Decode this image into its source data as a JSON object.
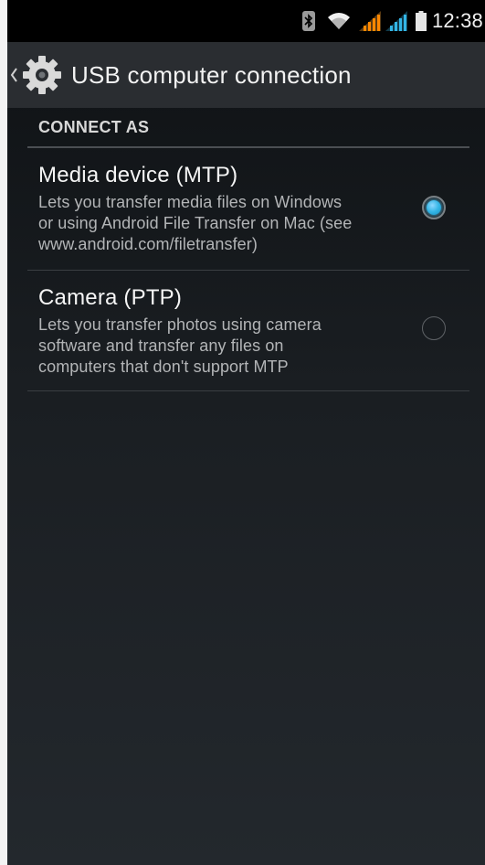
{
  "status_bar": {
    "time": "12:38",
    "icons": [
      "bluetooth-icon",
      "wifi-icon",
      "signal-icon",
      "signal-icon",
      "battery-icon"
    ],
    "colors": {
      "signal_sim1": "#ff8800",
      "signal_sim2": "#33b5e5"
    }
  },
  "action_bar": {
    "title": "USB computer connection",
    "up_icon": "chevron-left-icon",
    "app_icon": "settings-gear-icon"
  },
  "section": {
    "header": "CONNECT AS"
  },
  "options": [
    {
      "title": "Media device (MTP)",
      "summary_lines": [
        "Lets you transfer media files on Windows",
        "or using Android File Transfer on Mac (see",
        "www.android.com/filetransfer)"
      ],
      "checked": true
    },
    {
      "title": "Camera (PTP)",
      "summary_lines": [
        "Lets you transfer photos using camera",
        "software and transfer any files on",
        "computers that don't support MTP"
      ],
      "checked": false
    }
  ],
  "theme": {
    "accent": "#33b5e5",
    "action_bar_bg": "#2a2d31",
    "status_bar_bg": "#000000"
  }
}
